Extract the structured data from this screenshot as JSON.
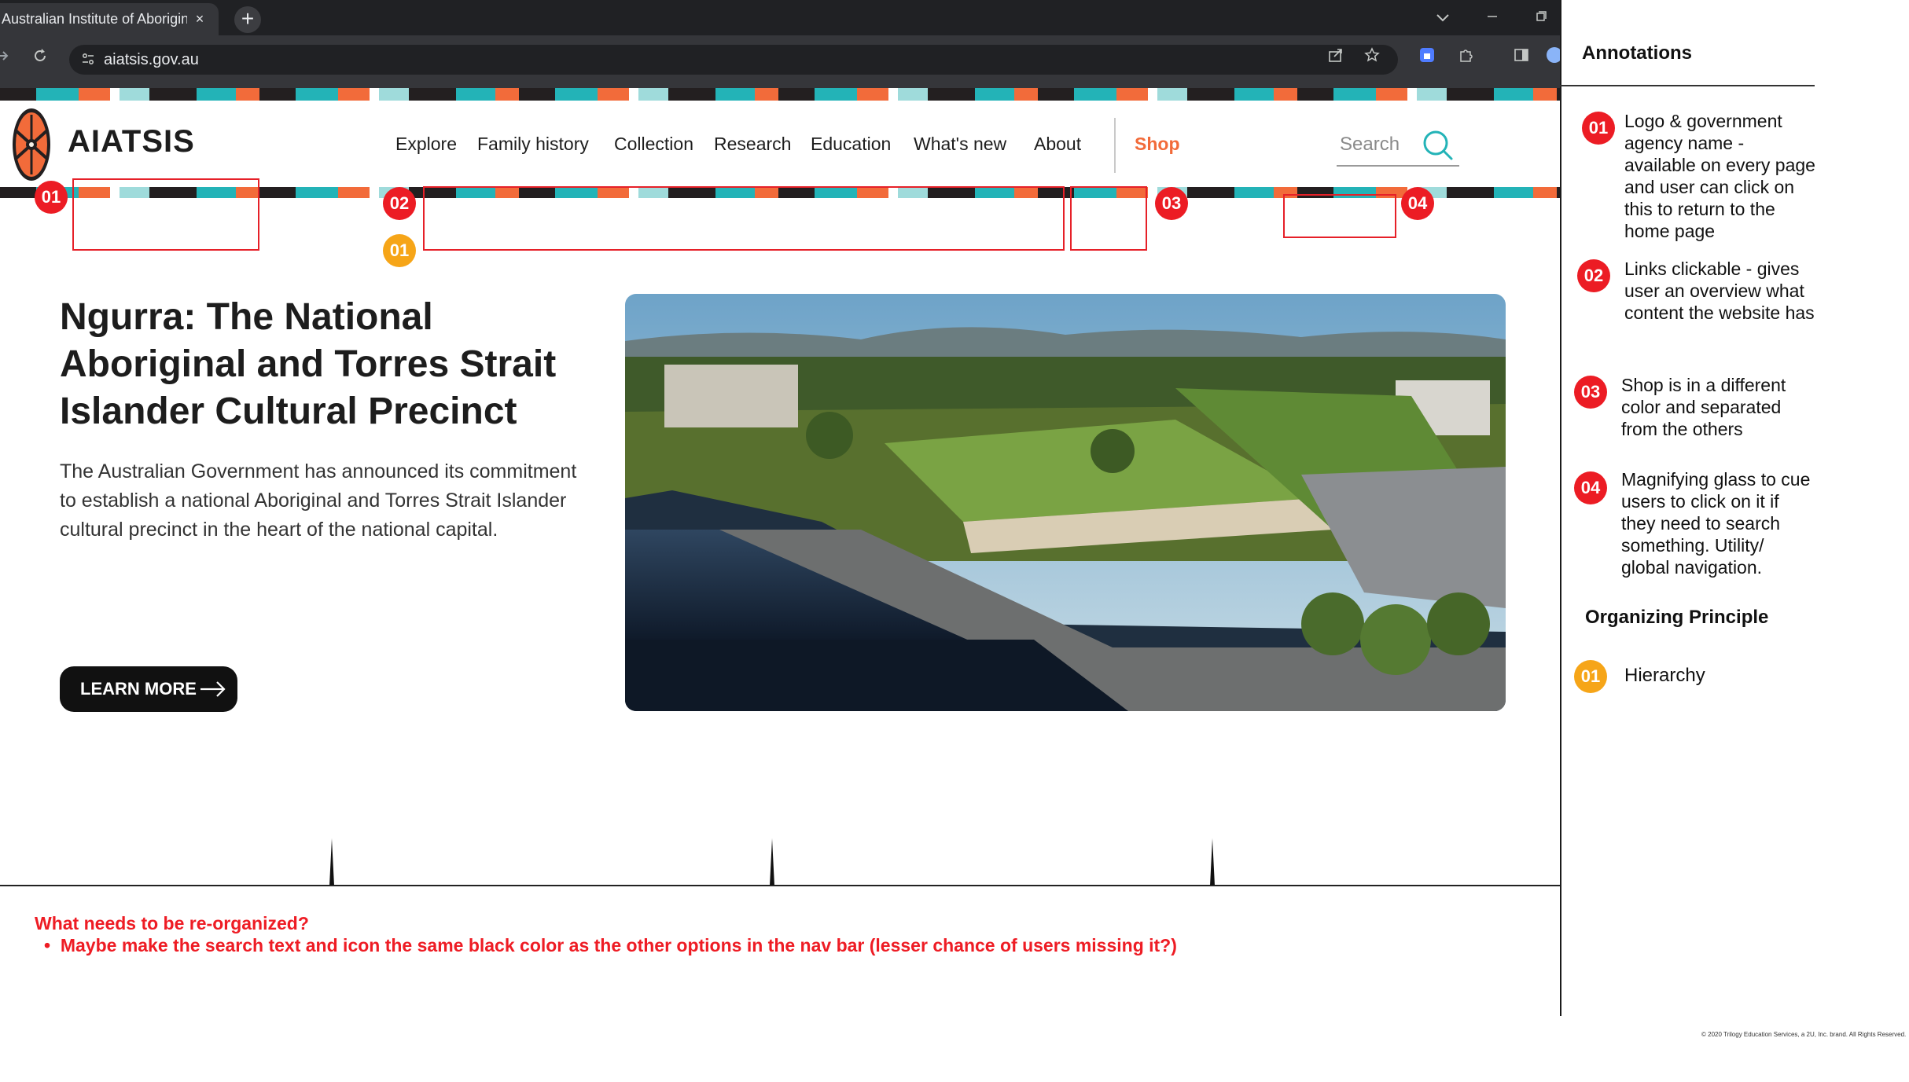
{
  "browser": {
    "tab_title": "Australian Institute of Aborigina",
    "tab_close": "×",
    "new_tab": "+",
    "url": "aiatsis.gov.au"
  },
  "site": {
    "brand": "AIATSIS",
    "nav": [
      "Explore",
      "Family history",
      "Collection",
      "Research",
      "Education",
      "What's new",
      "About"
    ],
    "shop": "Shop",
    "search_placeholder": "Search",
    "hero": {
      "title": "Ngurra: The National Aboriginal and Torres Strait Islander Cultural Precinct",
      "body": "The Australian Government has announced its commitment to establish a national Aboriginal and Torres Strait Islander cultural precinct in the heart of the national capital.",
      "cta": "LEARN MORE"
    }
  },
  "markers": {
    "logo": "01",
    "nav": "02",
    "hierarchy": "01",
    "shop": "03",
    "search": "04"
  },
  "note": {
    "heading": "What needs to be re-organized?",
    "item": "Maybe make the search text and icon the same black color as the other options in the nav bar (lesser chance of users missing it?)"
  },
  "panel": {
    "title": "Annotations",
    "annotations": [
      {
        "num": "01",
        "text": "Logo & government agency name - available on every page and user can click on this to return to the home page"
      },
      {
        "num": "02",
        "text": "Links clickable - gives user an overview what content the website has"
      },
      {
        "num": "03",
        "text": "Shop is in a different color and separated from the others"
      },
      {
        "num": "04",
        "text": "Magnifying glass to cue users to click on it if they need to search something. Utility/ global navigation."
      }
    ],
    "organizing_title": "Organizing Principle",
    "organizing": {
      "num": "01",
      "text": "Hierarchy"
    },
    "copyright": "© 2020 Trilogy Education Services, a 2U, Inc. brand. All Rights Reserved."
  },
  "colors": {
    "accent_orange": "#f26b3a",
    "accent_teal": "#23b3b7",
    "marker_red": "#ec1c24",
    "marker_yellow": "#f6a518"
  }
}
